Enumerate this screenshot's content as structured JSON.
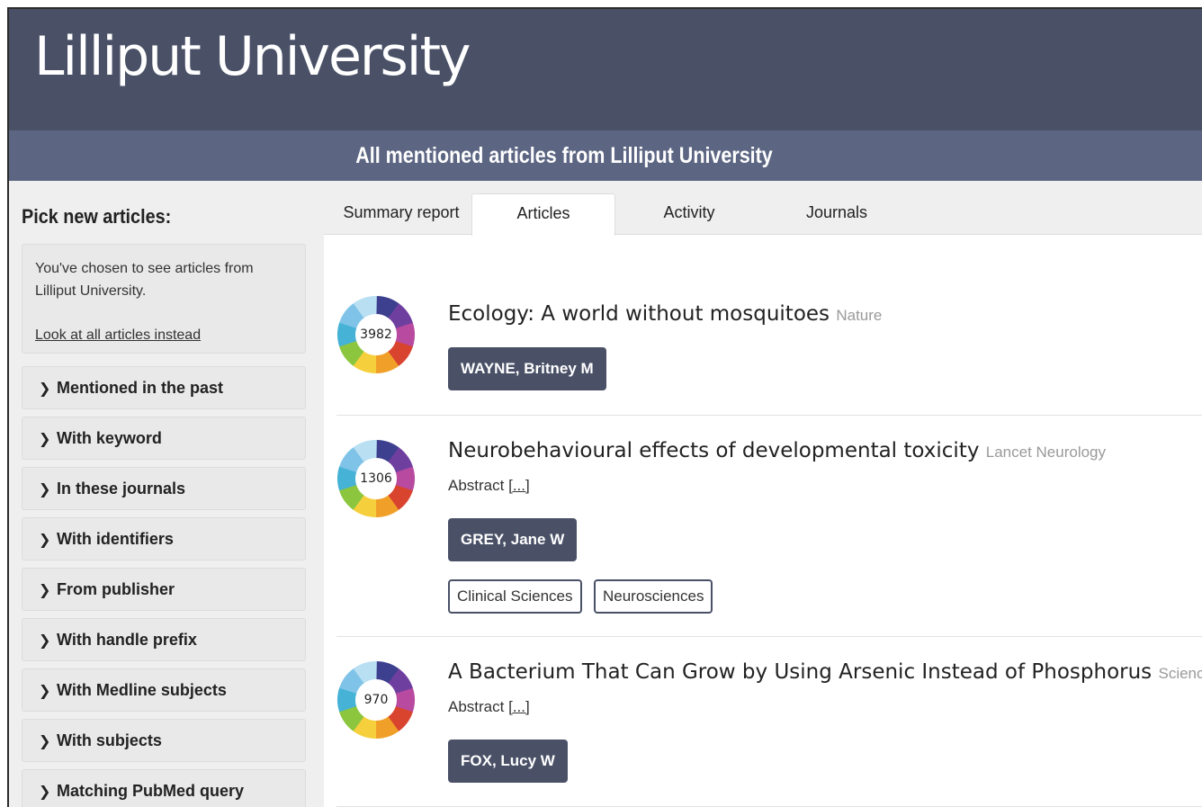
{
  "site": {
    "title": "Lilliput University"
  },
  "subbar": {
    "title": "All mentioned articles from Lilliput University"
  },
  "sidebar": {
    "heading": "Pick new articles:",
    "info": {
      "text": "You've chosen to see articles from Lilliput University.",
      "link": "Look at all articles instead"
    },
    "filters": [
      "Mentioned in the past",
      "With keyword",
      "In these journals",
      "With identifiers",
      "From publisher",
      "With handle prefix",
      "With Medline subjects",
      "With subjects",
      "Matching PubMed query"
    ],
    "chevron_glyph": "❯"
  },
  "tabs": [
    {
      "label": "Summary report",
      "active": false
    },
    {
      "label": "Articles",
      "active": true
    },
    {
      "label": "Activity",
      "active": false
    },
    {
      "label": "Journals",
      "active": false
    }
  ],
  "articles": [
    {
      "score": "3982",
      "title": "Ecology: A world without mosquitoes",
      "journal": "Nature",
      "abstract": "",
      "authors": [
        "WAYNE, Britney M"
      ],
      "subjects": []
    },
    {
      "score": "1306",
      "title": "Neurobehavioural effects of developmental toxicity",
      "journal": "Lancet Neurology",
      "abstract": "Abstract",
      "more": "[...]",
      "authors": [
        "GREY, Jane W"
      ],
      "subjects": [
        "Clinical Sciences",
        "Neurosciences"
      ]
    },
    {
      "score": "970",
      "title": "A Bacterium That Can Grow by Using Arsenic Instead of Phosphorus",
      "journal": "Science",
      "abstract": "Abstract",
      "more": "[...]",
      "authors": [
        "FOX, Lucy W"
      ],
      "subjects": []
    }
  ],
  "colors": {
    "masthead": "#4a5167",
    "subbar": "#5c6683",
    "donut": [
      "#3d3f8f",
      "#6f3fa0",
      "#b84aa0",
      "#d9442f",
      "#f0a028",
      "#f5d03c",
      "#8cc63f",
      "#45b2d6",
      "#7fc4e8",
      "#b9dff2"
    ]
  }
}
